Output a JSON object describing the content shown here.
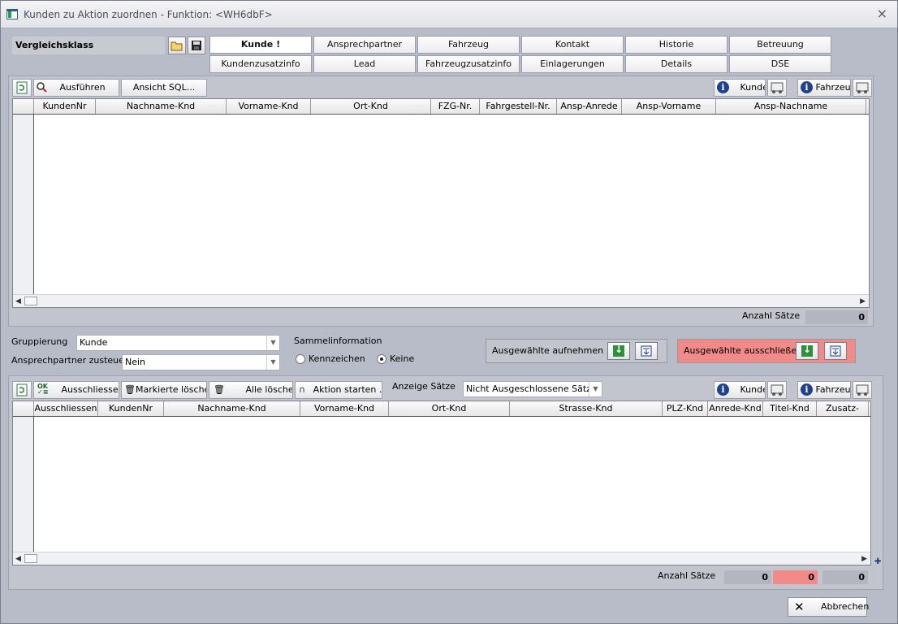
{
  "window": {
    "title": "Kunden zu Aktion zuordnen - Funktion: <WH6dbF>",
    "close_glyph": "×"
  },
  "top": {
    "vergleichsklass_label": "Vergleichsklass",
    "tabs_row1": [
      "Kunde !",
      "Ansprechpartner",
      "Fahrzeug",
      "Kontakt",
      "Historie",
      "Betreuung"
    ],
    "tabs_row2": [
      "Kundenzusatzinfo",
      "Lead",
      "Fahrzeugzusatzinfo",
      "Einlagerungen",
      "Details",
      "DSE"
    ]
  },
  "upper": {
    "ausfuehren_label": "Ausführen",
    "ansicht_sql_label": "Ansicht SQL...",
    "kunde_label": "Kunde",
    "fahrzeug_label": "Fahrzeug",
    "columns": [
      "KundenNr",
      "Nachname-Knd",
      "Vorname-Knd",
      "Ort-Knd",
      "FZG-Nr.",
      "Fahrgestell-Nr.",
      "Ansp-Anrede",
      "Ansp-Vorname",
      "Ansp-Nachname"
    ],
    "anzahl_label": "Anzahl Sätze",
    "anzahl_value": "0"
  },
  "middle": {
    "gruppierung_label": "Gruppierung",
    "gruppierung_value": "Kunde",
    "ansprechpartner_label": "Ansprechpartner zusteuern",
    "ansprechpartner_value": "Nein",
    "sammelinfo_label": "Sammelinformation",
    "radio_kennzeichen": "Kennzeichen",
    "radio_keine": "Keine",
    "aufnehmen_label": "Ausgewählte aufnehmen",
    "ausschliessen_label": "Ausgewählte ausschließen"
  },
  "lower": {
    "ausschliessen_btn": "Ausschliessen",
    "markierte_loeschen_btn": "Markierte löschen",
    "alle_loeschen_btn": "Alle löschen",
    "aktion_starten_btn": "Aktion starten ...",
    "anzeige_saetze_label": "Anzeige Sätze",
    "anzeige_saetze_value": "Nicht Ausgeschlossene Sätze",
    "kunde_label": "Kunde",
    "fahrzeug_label": "Fahrzeug",
    "columns": [
      "Ausschliessen",
      "KundenNr",
      "Nachname-Knd",
      "Vorname-Knd",
      "Ort-Knd",
      "Strasse-Knd",
      "PLZ-Knd",
      "Anrede-Knd",
      "Titel-Knd",
      "Zusatz-"
    ],
    "anzahl_label": "Anzahl Sätze",
    "count_1": "0",
    "count_2": "0",
    "count_3": "0"
  },
  "footer": {
    "abbrechen_label": "Abbrechen"
  }
}
